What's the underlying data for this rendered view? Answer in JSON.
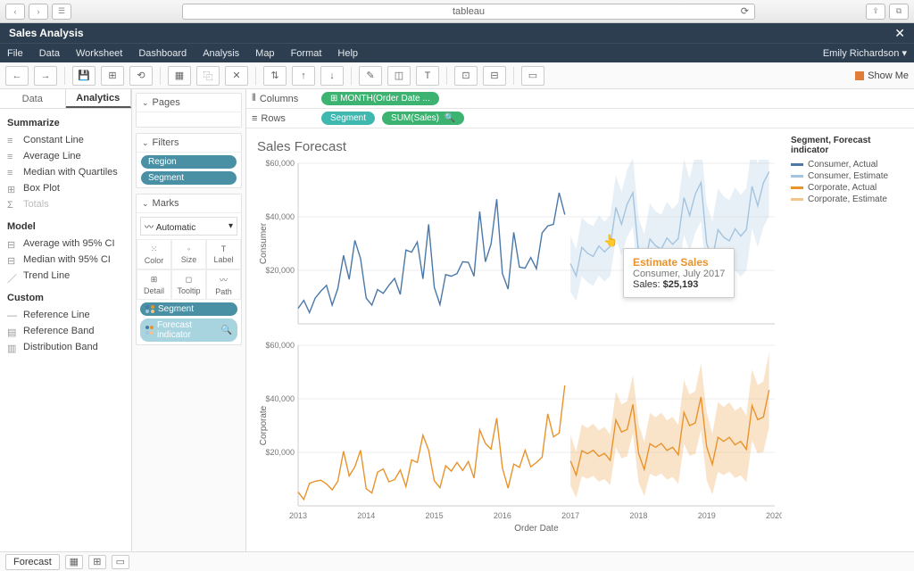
{
  "browser": {
    "address": "tableau"
  },
  "window": {
    "title": "Sales Analysis",
    "close": "✕"
  },
  "menubar": [
    "File",
    "Data",
    "Worksheet",
    "Dashboard",
    "Analysis",
    "Map",
    "Format",
    "Help"
  ],
  "user": "Emily Richardson ▾",
  "showme": "Show Me",
  "left_tabs": {
    "data": "Data",
    "analytics": "Analytics"
  },
  "analytics": {
    "summarize_h": "Summarize",
    "summarize": [
      "Constant Line",
      "Average Line",
      "Median with Quartiles",
      "Box Plot",
      "Totals"
    ],
    "model_h": "Model",
    "model": [
      "Average with 95% CI",
      "Median with 95% CI",
      "Trend Line"
    ],
    "custom_h": "Custom",
    "custom": [
      "Reference Line",
      "Reference Band",
      "Distribution Band"
    ]
  },
  "cards": {
    "pages": "Pages",
    "filters": "Filters",
    "filter_items": [
      "Region",
      "Segment"
    ],
    "marks": "Marks",
    "mark_type": "Automatic",
    "mark_cells": [
      "Color",
      "Size",
      "Label",
      "Detail",
      "Tooltip",
      "Path"
    ],
    "shelf_segment": "Segment",
    "shelf_forecast": "Forecast indicator"
  },
  "shelves": {
    "columns": "Columns",
    "columns_pill": "⊞ MONTH(Order Date ...",
    "rows": "Rows",
    "rows_pill1": "Segment",
    "rows_pill2": "SUM(Sales)"
  },
  "chart_title": "Sales Forecast",
  "legend": {
    "title": "Segment, Forecast indicator",
    "items": [
      {
        "label": "Consumer, Actual",
        "color": "#4a78a8"
      },
      {
        "label": "Consumer, Estimate",
        "color": "#a3c4e0"
      },
      {
        "label": "Corporate, Actual",
        "color": "#e8932c"
      },
      {
        "label": "Corporate, Estimate",
        "color": "#f4c58a"
      }
    ]
  },
  "tooltip": {
    "title": "Estimate Sales",
    "sub": "Consumer, July 2017",
    "sales_label": "Sales: ",
    "sales_value": "$25,193"
  },
  "footer": {
    "tab": "Forecast"
  },
  "chart_data": {
    "type": "line",
    "title": "Sales Forecast",
    "xlabel": "Order Date",
    "x_years": [
      2013,
      2014,
      2015,
      2016,
      2017,
      2018,
      2019,
      2020
    ],
    "panels": [
      {
        "name": "Consumer",
        "ylabel": "Consumer",
        "ylim": [
          0,
          60000
        ],
        "yticks": [
          0,
          20000,
          40000,
          60000
        ],
        "series": [
          {
            "name": "Consumer, Actual",
            "color": "#4a78a8",
            "values": [
              5800,
              8800,
              4200,
              9600,
              12200,
              14400,
              7000,
              13200,
              25600,
              16600,
              31200,
              24400,
              9600,
              7000,
              12800,
              11400,
              14400,
              17000,
              11000,
              27600,
              26800,
              30600,
              16800,
              37200,
              13600,
              7200,
              18400,
              17800,
              18800,
              23200,
              23000,
              17800,
              42000,
              23200,
              29800,
              46600,
              18800,
              13000,
              34200,
              21200,
              20800,
              24800,
              20600,
              34000,
              36600,
              37200,
              49000,
              40800
            ]
          },
          {
            "name": "Consumer, Estimate",
            "color": "#a3c4e0",
            "values": [
              22500,
              17900,
              28600,
              26400,
              25200,
              29100,
              26900,
              29000,
              43500,
              37200,
              44800,
              49000,
              26500,
              21200,
              31700,
              29200,
              27900,
              32100,
              29700,
              31900,
              47200,
              40500,
              48500,
              52800,
              30000,
              24200,
              35200,
              32400,
              31000,
              35500,
              32800,
              35200,
              51400,
              44100,
              52700,
              56800
            ],
            "band_lo": [
              12000,
              8500,
              17800,
              15500,
              14200,
              18000,
              15800,
              17800,
              31500,
              25600,
              32600,
              36300,
              13800,
              9200,
              18800,
              16500,
              15200,
              19100,
              16700,
              18800,
              33300,
              27000,
              34100,
              38400,
              15500,
              10400,
              20200,
              17400,
              16000,
              20200,
              17600,
              19900,
              35600,
              28700,
              36100,
              40300
            ],
            "band_hi": [
              33000,
              27800,
              39800,
              37600,
              36500,
              40500,
              38200,
              40600,
              55600,
              49200,
              57600,
              62100,
              39600,
              33600,
              45000,
              42100,
              40900,
              45500,
              42900,
              45200,
              61500,
              54200,
              63300,
              67500,
              44800,
              38200,
              50600,
              47600,
              46200,
              51000,
              48200,
              50800,
              67500,
              59700,
              69600,
              73600
            ]
          }
        ]
      },
      {
        "name": "Corporate",
        "ylabel": "Corporate",
        "ylim": [
          0,
          60000
        ],
        "yticks": [
          0,
          20000,
          40000,
          60000
        ],
        "series": [
          {
            "name": "Corporate, Actual",
            "color": "#e8932c",
            "values": [
              5200,
              2400,
              8400,
              9200,
              9600,
              8200,
              6000,
              9200,
              20400,
              11200,
              14600,
              20800,
              6400,
              4800,
              12600,
              13800,
              9000,
              9800,
              13400,
              7200,
              17200,
              16200,
              26400,
              20800,
              9400,
              6800,
              15000,
              13000,
              16200,
              13200,
              16600,
              10400,
              28400,
              23400,
              21200,
              32800,
              14200,
              6600,
              15600,
              14400,
              20800,
              14600,
              16200,
              18200,
              34400,
              25800,
              27200,
              45000
            ]
          },
          {
            "name": "Corporate, Estimate",
            "color": "#e8932c",
            "values": [
              16800,
              11500,
              20600,
              19500,
              20800,
              18500,
              19600,
              17000,
              32100,
              27600,
              28600,
              37900,
              19600,
              13600,
              23200,
              21900,
              23300,
              20700,
              21900,
              19100,
              34900,
              30000,
              31000,
              40700,
              22100,
              15500,
              25600,
              24100,
              25600,
              22800,
              24100,
              21100,
              37500,
              32200,
              33200,
              43300
            ],
            "band_lo": [
              7500,
              3100,
              11100,
              10100,
              11200,
              9100,
              10000,
              7700,
              21800,
              17700,
              18500,
              27200,
              8700,
              3700,
              12000,
              10900,
              12100,
              9800,
              10800,
              8200,
              23100,
              18700,
              19400,
              28400,
              9600,
              4200,
              12700,
              11500,
              12800,
              10400,
              11400,
              8800,
              24300,
              19600,
              20200,
              29400
            ],
            "band_hi": [
              26500,
              20200,
              30400,
              29100,
              30700,
              28200,
              29500,
              26600,
              42800,
              37900,
              39100,
              49000,
              30700,
              23800,
              34700,
              33100,
              34800,
              31900,
              33300,
              30200,
              47000,
              41600,
              42900,
              53300,
              34900,
              27000,
              38800,
              36900,
              38700,
              35500,
              37100,
              33700,
              51000,
              45100,
              46500,
              57500
            ]
          }
        ]
      }
    ]
  }
}
